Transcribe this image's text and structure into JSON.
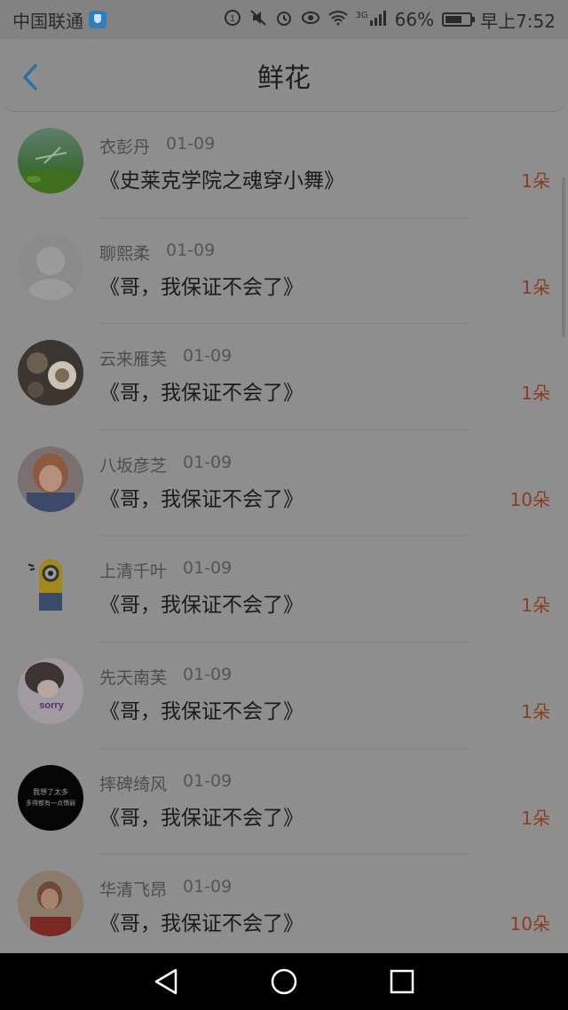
{
  "status_bar": {
    "carrier": "中国联通",
    "battery_percent": "66%",
    "time": "早上7:52",
    "network": "3G",
    "icons": [
      "vpn-shield-icon",
      "data-saver-icon",
      "mute-icon",
      "alarm-icon",
      "eye-icon",
      "wifi-icon",
      "signal-icon",
      "battery-icon"
    ]
  },
  "header": {
    "title": "鲜花",
    "back_icon": "back-arrow-icon"
  },
  "rows": [
    {
      "name": "衣彭丹",
      "date": "01-09",
      "book": "《史莱克学院之魂穿小舞》",
      "count": "1朵"
    },
    {
      "name": "聊熙柔",
      "date": "01-09",
      "book": "《哥，我保证不会了》",
      "count": "1朵"
    },
    {
      "name": "云来雁芙",
      "date": "01-09",
      "book": "《哥，我保证不会了》",
      "count": "1朵"
    },
    {
      "name": "八坂彦芝",
      "date": "01-09",
      "book": "《哥，我保证不会了》",
      "count": "10朵"
    },
    {
      "name": "上清千叶",
      "date": "01-09",
      "book": "《哥，我保证不会了》",
      "count": "1朵"
    },
    {
      "name": "先天南芙",
      "date": "01-09",
      "book": "《哥，我保证不会了》",
      "count": "1朵"
    },
    {
      "name": "摔碑绮风",
      "date": "01-09",
      "book": "《哥，我保证不会了》",
      "count": "1朵"
    },
    {
      "name": "华清飞昂",
      "date": "01-09",
      "book": "《哥，我保证不会了》",
      "count": "10朵"
    }
  ],
  "avatar_texts": {
    "row5": "sorry",
    "row6_line1": "我想了太多",
    "row6_line2": "多得都有一点懦弱"
  },
  "nav_bar": {
    "icons": [
      "back-triangle-icon",
      "home-circle-icon",
      "recents-square-icon"
    ]
  },
  "colors": {
    "count_text": "#8a3d1f",
    "back_arrow": "#2a6fa6",
    "overlay_bg": "#8e8e8e"
  }
}
